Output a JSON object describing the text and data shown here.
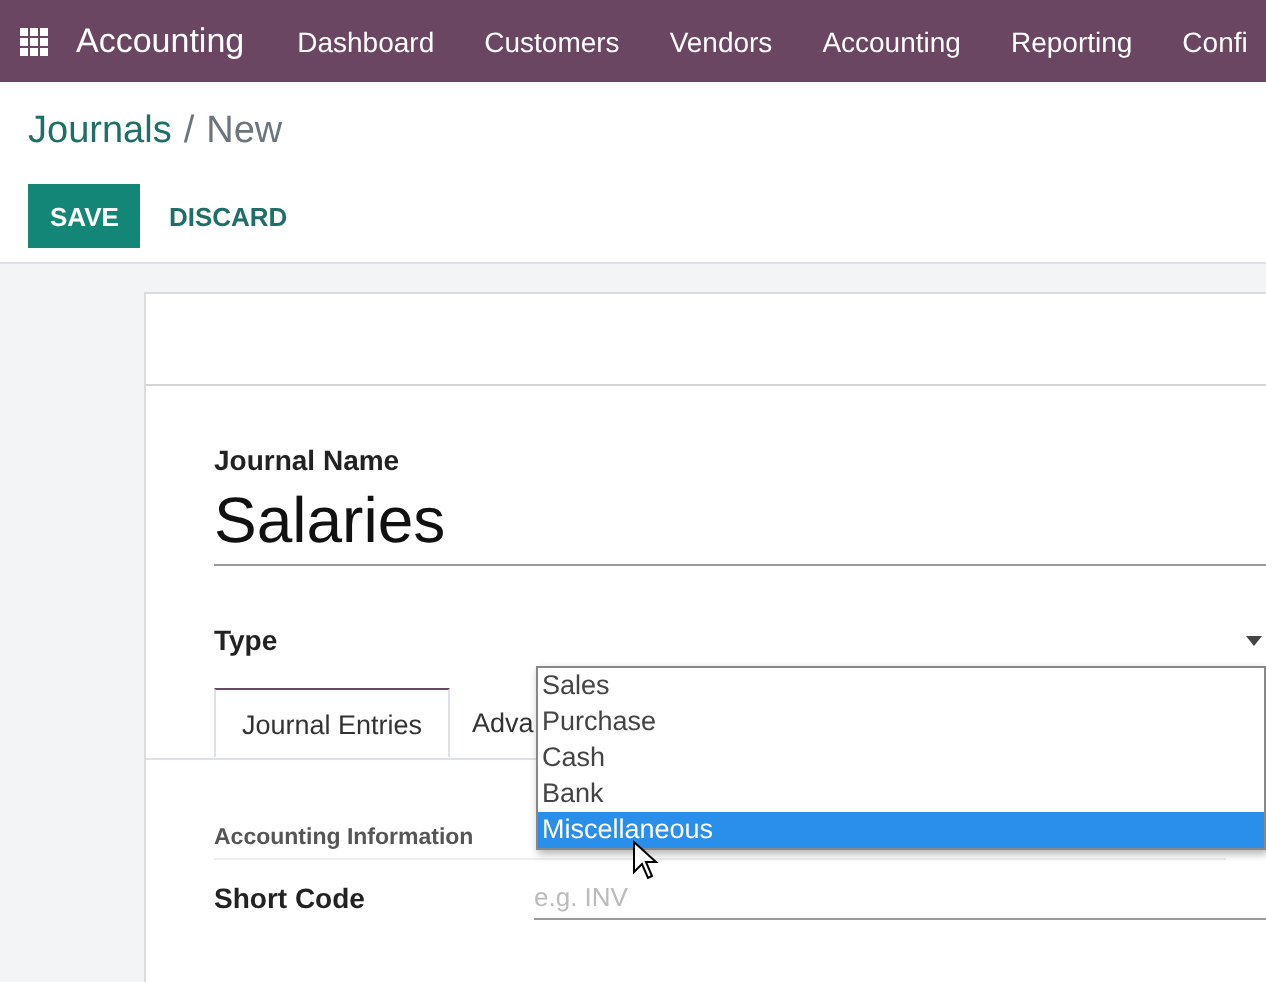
{
  "navbar": {
    "app_name": "Accounting",
    "menu": [
      "Dashboard",
      "Customers",
      "Vendors",
      "Accounting",
      "Reporting",
      "Confi"
    ]
  },
  "breadcrumb": {
    "parent": "Journals",
    "separator": "/",
    "current": "New"
  },
  "buttons": [
    {
      "label": "SAVE",
      "kind": "primary"
    },
    {
      "label": "DISCARD",
      "kind": "secondary"
    }
  ],
  "form": {
    "name_label": "Journal Name",
    "name_value": "Salaries",
    "type_label": "Type",
    "type_options": [
      {
        "label": "Sales",
        "selected": false
      },
      {
        "label": "Purchase",
        "selected": false
      },
      {
        "label": "Cash",
        "selected": false
      },
      {
        "label": "Bank",
        "selected": false
      },
      {
        "label": "Miscellaneous",
        "selected": true
      }
    ],
    "tabs": [
      {
        "label": "Journal Entries",
        "selected": true
      },
      {
        "label": "Adva",
        "selected": false
      }
    ],
    "section_title": "Accounting Information",
    "fields": [
      {
        "label": "Short Code",
        "placeholder": "e.g. INV"
      }
    ]
  }
}
